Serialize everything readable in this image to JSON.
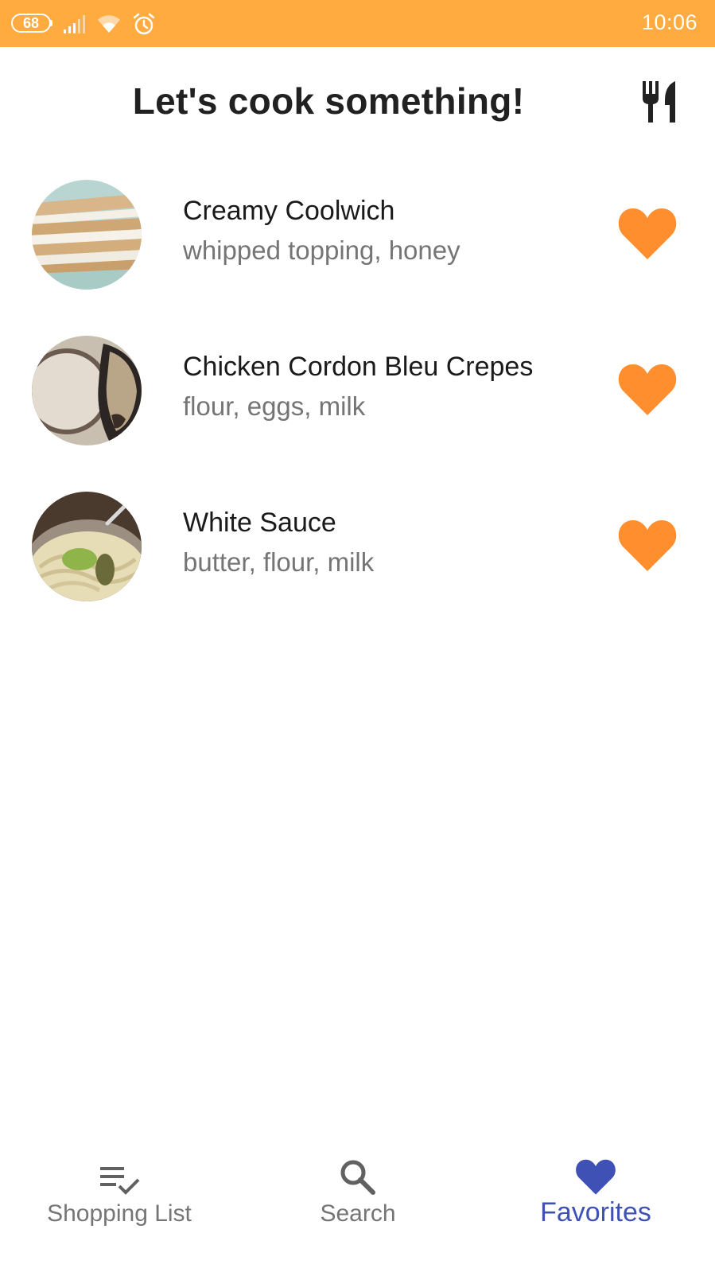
{
  "status_bar": {
    "battery": "68",
    "time": "10:06",
    "icons": [
      "battery-icon",
      "signal-icon",
      "wifi-icon",
      "alarm-icon"
    ]
  },
  "header": {
    "title": "Let's cook something!",
    "icon": "cutlery-icon"
  },
  "recipes": [
    {
      "name": "Creamy Coolwich",
      "ingredients": "whipped topping, honey",
      "favorite": true
    },
    {
      "name": "Chicken Cordon Bleu Crepes",
      "ingredients": "flour, eggs, milk",
      "favorite": true
    },
    {
      "name": "White Sauce",
      "ingredients": "butter, flour, milk",
      "favorite": true
    }
  ],
  "bottom_nav": {
    "items": [
      {
        "label": "Shopping List",
        "icon": "playlist-check-icon",
        "active": false
      },
      {
        "label": "Search",
        "icon": "search-icon",
        "active": false
      },
      {
        "label": "Favorites",
        "icon": "heart-icon",
        "active": true
      }
    ]
  },
  "colors": {
    "status_bar": "#FFAB40",
    "heart": "#FF8F2E",
    "active_nav": "#3F51B5",
    "inactive_nav": "#757575",
    "title": "#212121"
  }
}
